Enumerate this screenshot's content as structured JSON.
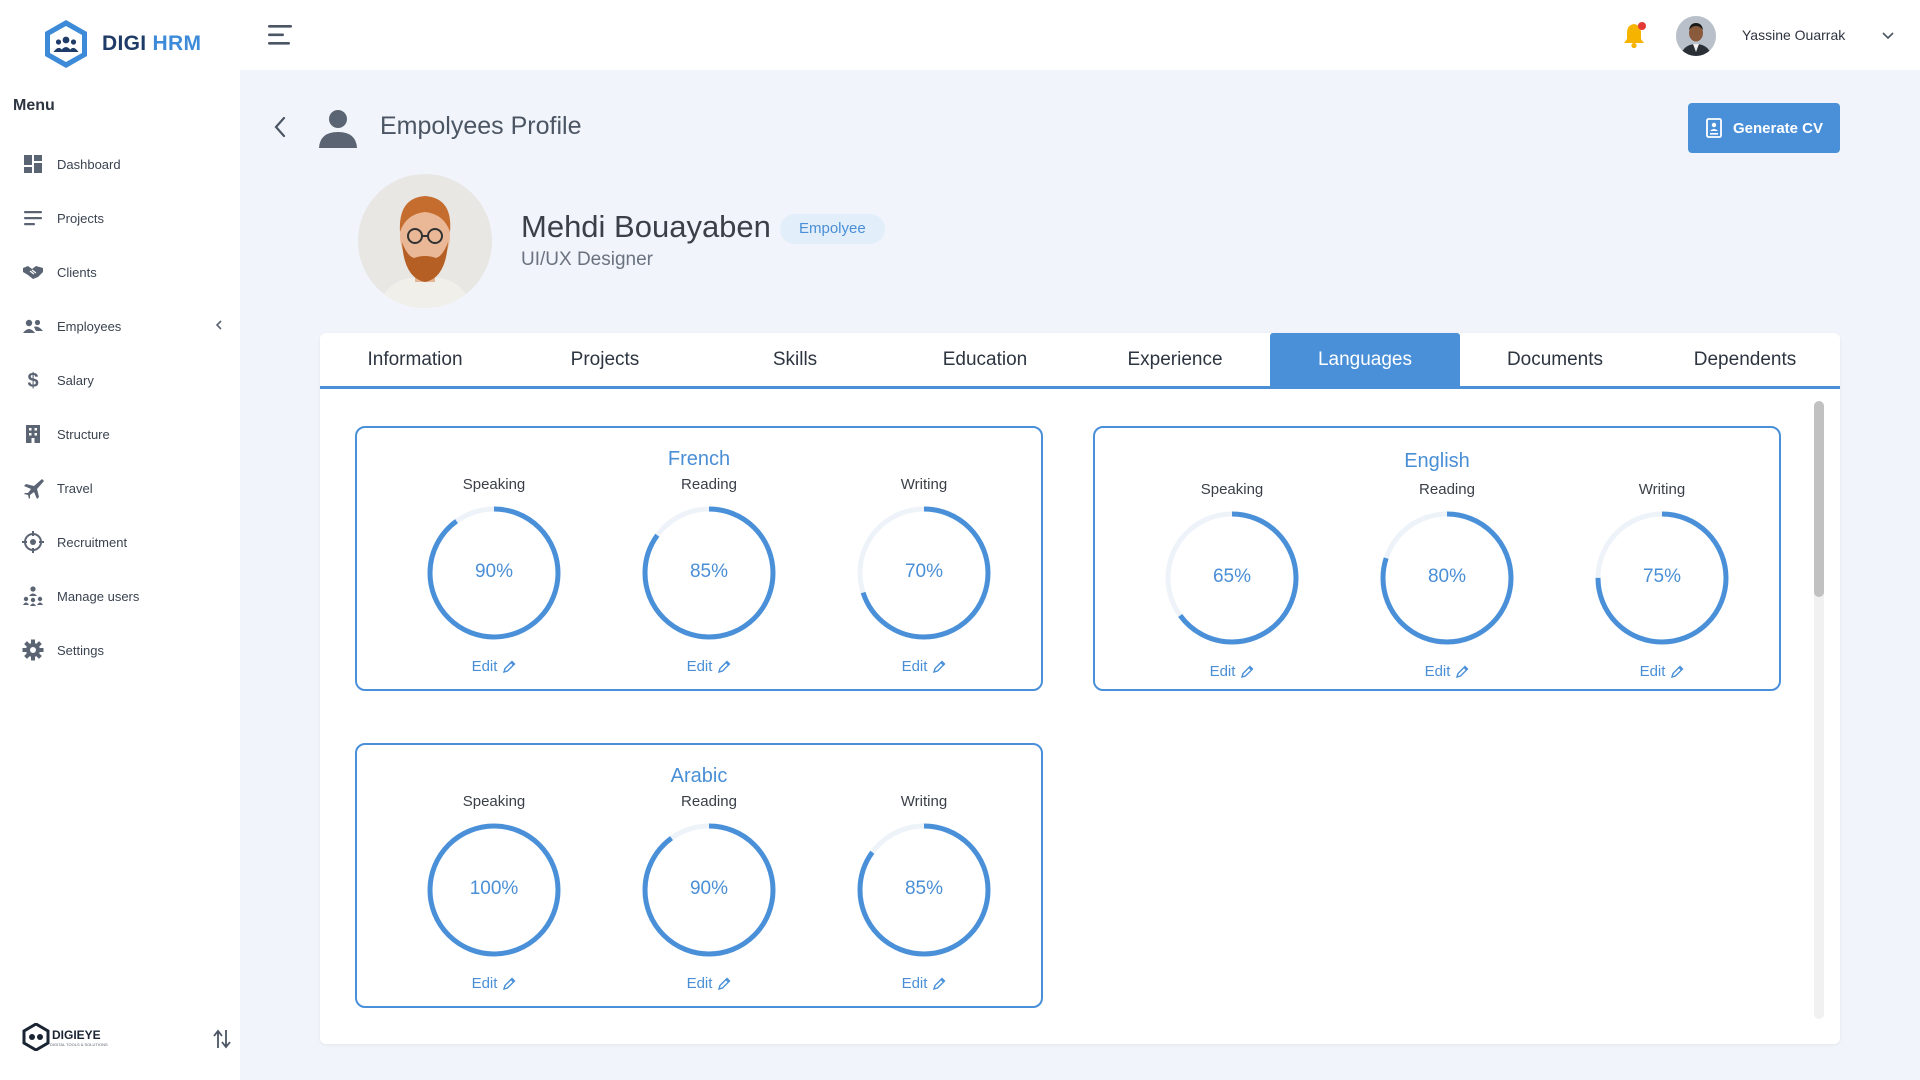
{
  "brand": {
    "part1": "DIGI",
    "part2": "HRM",
    "footer_name": "DIGIEYE",
    "footer_tagline": "DIGITAL TOOLS & SOLUTIONS"
  },
  "sidebar": {
    "title": "Menu",
    "items": [
      {
        "label": "Dashboard",
        "icon": "dashboard-icon"
      },
      {
        "label": "Projects",
        "icon": "projects-icon"
      },
      {
        "label": "Clients",
        "icon": "handshake-icon"
      },
      {
        "label": "Employees",
        "icon": "employees-icon",
        "expandable": true
      },
      {
        "label": "Salary",
        "icon": "dollar-icon"
      },
      {
        "label": "Structure",
        "icon": "building-icon"
      },
      {
        "label": "Travel",
        "icon": "plane-icon"
      },
      {
        "label": "Recruitment",
        "icon": "target-icon"
      },
      {
        "label": "Manage users",
        "icon": "users-hierarchy-icon"
      },
      {
        "label": "Settings",
        "icon": "gear-icon"
      }
    ]
  },
  "topbar": {
    "user_name": "Yassine Ouarrak"
  },
  "page": {
    "title": "Empolyees Profile",
    "generate_cv": "Generate CV"
  },
  "profile": {
    "name": "Mehdi Bouayaben",
    "badge": "Empolyee",
    "role": "UI/UX Designer"
  },
  "tabs": [
    {
      "label": "Information",
      "active": false
    },
    {
      "label": "Projects",
      "active": false
    },
    {
      "label": "Skills",
      "active": false
    },
    {
      "label": "Education",
      "active": false
    },
    {
      "label": "Experience",
      "active": false
    },
    {
      "label": "Languages",
      "active": true
    },
    {
      "label": "Documents",
      "active": false
    },
    {
      "label": "Dependents",
      "active": false
    }
  ],
  "languages": [
    {
      "name": "French",
      "skills": [
        {
          "label": "Speaking",
          "value": 90,
          "text": "90%"
        },
        {
          "label": "Reading",
          "value": 85,
          "text": "85%"
        },
        {
          "label": "Writing",
          "value": 70,
          "text": "70%"
        }
      ]
    },
    {
      "name": "English",
      "skills": [
        {
          "label": "Speaking",
          "value": 65,
          "text": "65%"
        },
        {
          "label": "Reading",
          "value": 80,
          "text": "80%"
        },
        {
          "label": "Writing",
          "value": 75,
          "text": "75%"
        }
      ]
    },
    {
      "name": "Arabic",
      "skills": [
        {
          "label": "Speaking",
          "value": 100,
          "text": "100%"
        },
        {
          "label": "Reading",
          "value": 90,
          "text": "90%"
        },
        {
          "label": "Writing",
          "value": 85,
          "text": "85%"
        }
      ]
    }
  ],
  "edit_label": "Edit",
  "colors": {
    "primary": "#4a90d9",
    "ring_track": "#eef3fa",
    "notification_dot": "#e53935",
    "bell": "#f6b400"
  }
}
